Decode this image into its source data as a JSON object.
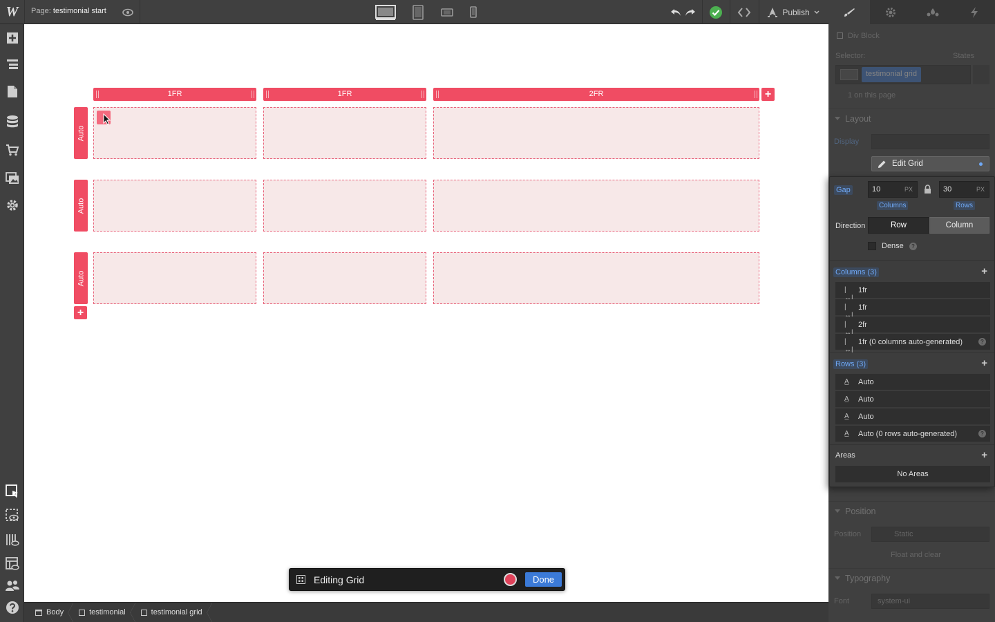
{
  "topbar": {
    "page_prefix": "Page:",
    "page_name": "testimonial start",
    "publish_label": "Publish"
  },
  "grid": {
    "columns": [
      "1FR",
      "1FR",
      "2FR"
    ],
    "rows": [
      "Auto",
      "Auto",
      "Auto"
    ]
  },
  "edit_bar": {
    "title": "Editing Grid",
    "done_label": "Done"
  },
  "breadcrumbs": [
    "Body",
    "testimonial",
    "testimonial grid"
  ],
  "panel": {
    "element_type": "Div Block",
    "selector_label": "Selector:",
    "states_label": "States",
    "selector_class": "testimonial grid",
    "on_page": "1 on this page",
    "layout_title": "Layout",
    "display_label": "Display",
    "edit_grid_label": "Edit Grid",
    "position_title": "Position",
    "position_label": "Position",
    "position_value": "Static",
    "float_clear": "Float and clear",
    "typography_title": "Typography",
    "font_label": "Font",
    "font_value": "system-ui"
  },
  "grid_settings": {
    "gap_label": "Gap",
    "gap_columns": "10",
    "gap_rows": "30",
    "unit": "PX",
    "columns_caption": "Columns",
    "rows_caption": "Rows",
    "direction_label": "Direction",
    "direction_row": "Row",
    "direction_column": "Column",
    "dense_label": "Dense",
    "columns_header": "Columns (3)",
    "column_items": [
      "1fr",
      "1fr",
      "2fr",
      "1fr (0 columns auto-generated)"
    ],
    "rows_header": "Rows (3)",
    "row_items": [
      "Auto",
      "Auto",
      "Auto",
      "Auto (0 rows auto-generated)"
    ],
    "areas_label": "Areas",
    "no_areas": "No Areas"
  },
  "colors": {
    "grid_accent": "#f04c63",
    "cell_fill": "#f7e8e8",
    "done_blue": "#3b7ad8",
    "status_green": "#4caf50"
  }
}
